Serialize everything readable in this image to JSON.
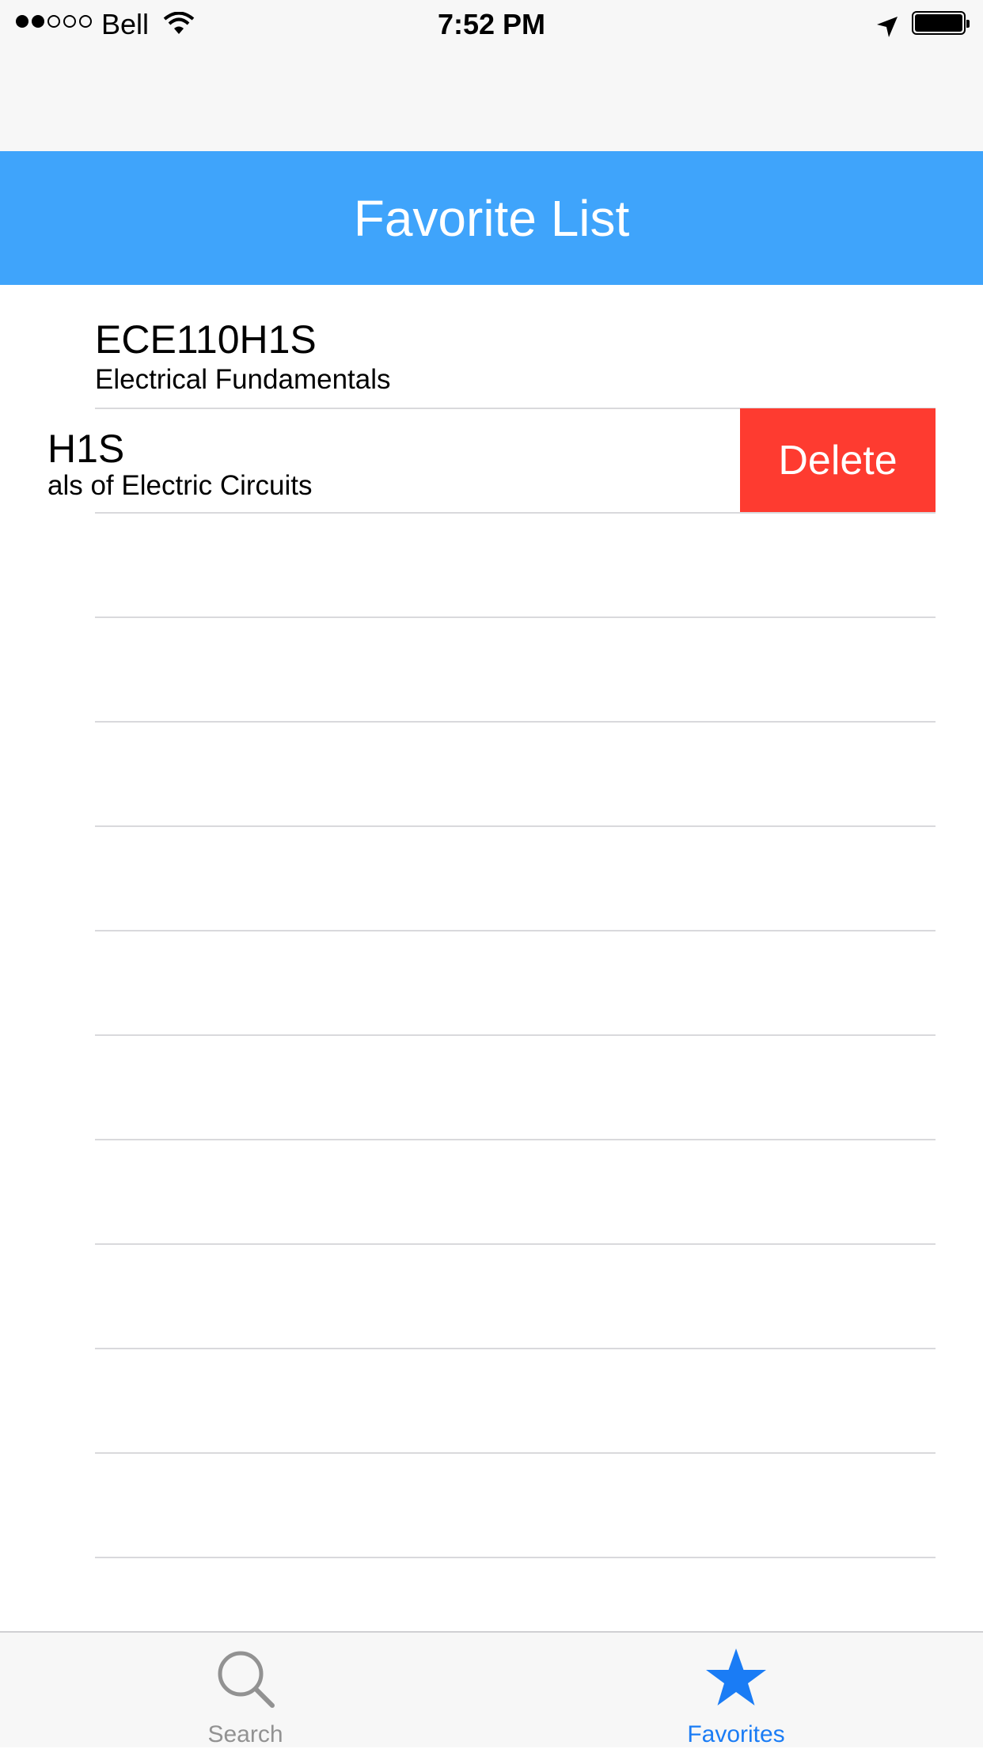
{
  "status_bar": {
    "carrier": "Bell",
    "time": "7:52 PM",
    "signal_bars_filled": 2,
    "signal_bars_total": 5
  },
  "header": {
    "title": "Favorite List"
  },
  "rows": [
    {
      "code": "ECE110H1S",
      "title": "Electrical Fundamentals"
    },
    {
      "code": "H1S",
      "title": "als of Electric Circuits",
      "swiped": true
    }
  ],
  "swipe_action": {
    "label": "Delete"
  },
  "tabbar": {
    "tabs": [
      {
        "label": "Search",
        "icon": "search-icon",
        "selected": false
      },
      {
        "label": "Favorites",
        "icon": "star-icon",
        "selected": true
      }
    ]
  },
  "colors": {
    "header_bg": "#3fa4fb",
    "delete_bg": "#fe3b30",
    "tab_selected": "#1a7cf5",
    "tab_unselected": "#929292"
  }
}
